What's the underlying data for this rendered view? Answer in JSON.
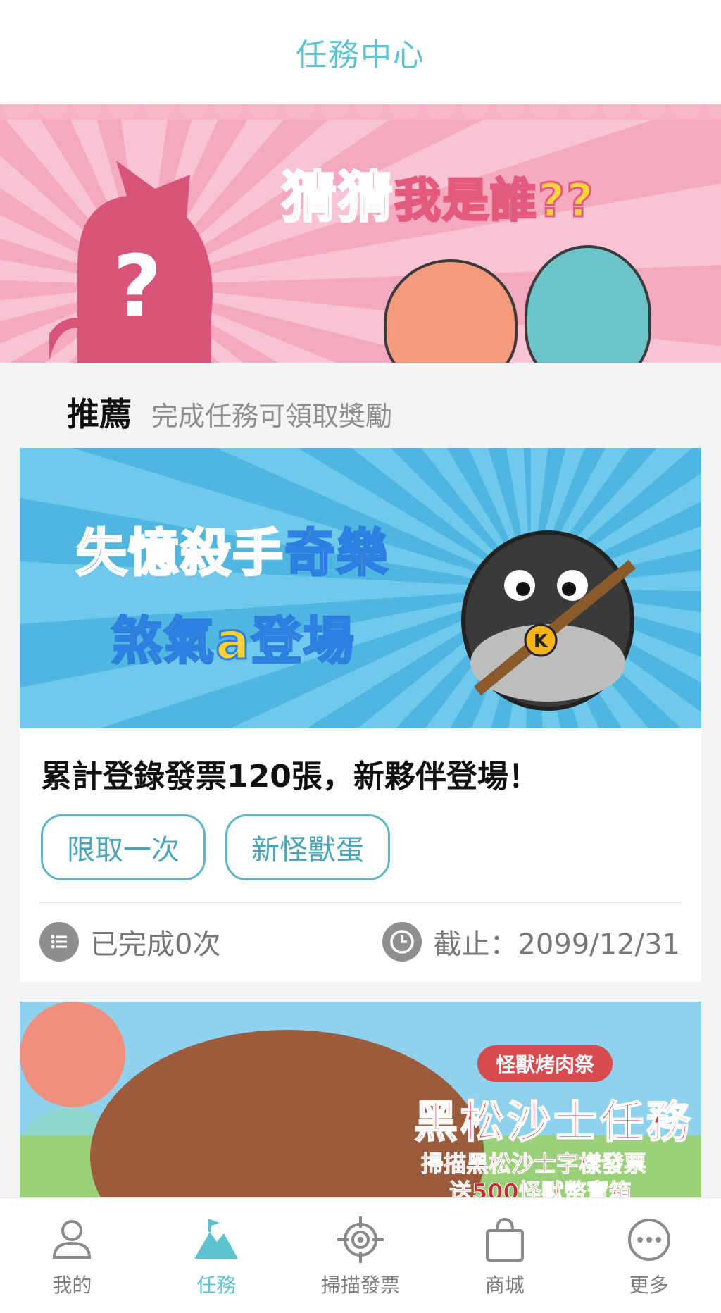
{
  "header": {
    "title": "任務中心"
  },
  "hero": {
    "title_main": "猜猜",
    "title_accent": "我是誰",
    "title_suffix": "??"
  },
  "section": {
    "title": "推薦",
    "subtitle": "完成任務可領取獎勵"
  },
  "card": {
    "image_line1_part1": "失憶殺手",
    "image_line1_part2": "奇樂",
    "image_line2": "煞氣a登場",
    "title": "累計登錄發票120張，新夥伴登場！",
    "tags": [
      "限取一次",
      "新怪獸蛋"
    ],
    "completed": "已完成0次",
    "deadline": "截止：2099/12/31"
  },
  "card2": {
    "pill": "怪獸烤肉祭",
    "title": "黑松沙士任務",
    "line1": "掃描黑松沙士字樣發票",
    "line2": "送500怪獸幣寶箱"
  },
  "nav": {
    "items": [
      {
        "label": "我的",
        "icon": "user-icon"
      },
      {
        "label": "任務",
        "icon": "mountain-flag-icon"
      },
      {
        "label": "掃描發票",
        "icon": "target-icon"
      },
      {
        "label": "商城",
        "icon": "shopping-bag-icon"
      },
      {
        "label": "更多",
        "icon": "more-icon"
      }
    ],
    "active_index": 1
  },
  "colors": {
    "accent": "#5cc3cf",
    "tag_border": "#5ab6c8"
  }
}
